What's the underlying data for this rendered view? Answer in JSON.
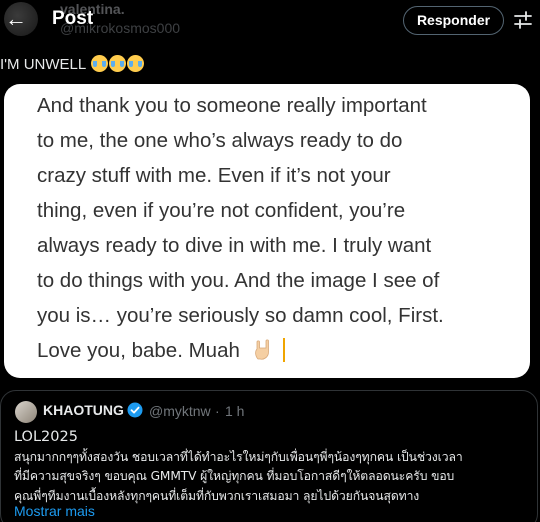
{
  "header": {
    "ghost_name": "valentina.",
    "ghost_handle": "@mikrokosmos000",
    "title": "Post",
    "reply_label": "Responder"
  },
  "tweet": {
    "text": "I'M UNWELL"
  },
  "image_text": {
    "line1": "And thank you to someone really important",
    "line2": "to me, the one who’s always ready to do",
    "line3": "crazy stuff with me. Even if it’s not your",
    "line4": "thing, even if you’re not confident, you’re",
    "line5": "always ready to dive in with me. I truly want",
    "line6": "to do things with you. And the image I see of",
    "line7": "you is… you’re seriously so damn cool, First.",
    "line8": "Love you, babe. Muah"
  },
  "quote": {
    "name": "KHAOTUNG",
    "handle": "@myktnw",
    "separator": "·",
    "time": "1 h",
    "line1": "LOL2025",
    "line2": "สนุกมากกๆๆทั้งสองวัน ชอบเวลาที่ได้ทำอะไรใหม่ๆกับเพื่อนๆพี่ๆน้องๆทุกคน เป็นช่วงเวลา",
    "line3": "ที่มีความสุขจริงๆ ขอบคุณ GMMTV ผู้ใหญ่ทุกคน ที่มอบโอกาสดีๆให้ตลอดนะครับ ขอบ",
    "line4": "คุณพี่ๆทีมงานเบื้องหลังทุกๆคนที่เต็มที่กับพวกเราเสมอมา ลุยไปด้วยกันจนสุดทาง",
    "show_more": "Mostrar mais"
  },
  "colors": {
    "background": "#000000",
    "link": "#1d9bf0",
    "verified": "#1d9bf0",
    "border": "#2f3336"
  }
}
